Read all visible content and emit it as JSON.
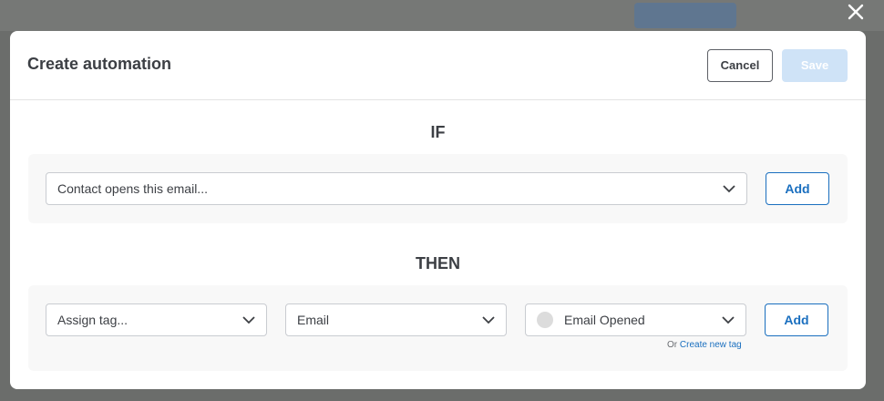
{
  "window": {
    "close_icon": "close-icon"
  },
  "modal": {
    "title": "Create automation",
    "cancel_label": "Cancel",
    "save_label": "Save"
  },
  "if_section": {
    "label": "IF",
    "trigger_select": "Contact opens this email...",
    "add_label": "Add"
  },
  "then_section": {
    "label": "THEN",
    "action_select": "Assign tag...",
    "category_select": "Email",
    "tag_select": "Email Opened",
    "add_label": "Add",
    "hint_prefix": "Or",
    "hint_link": "Create new tag"
  },
  "colors": {
    "accent": "#1a6fbf",
    "save_disabled": "#cfe3f7",
    "panel_bg": "#f8f8f8"
  }
}
